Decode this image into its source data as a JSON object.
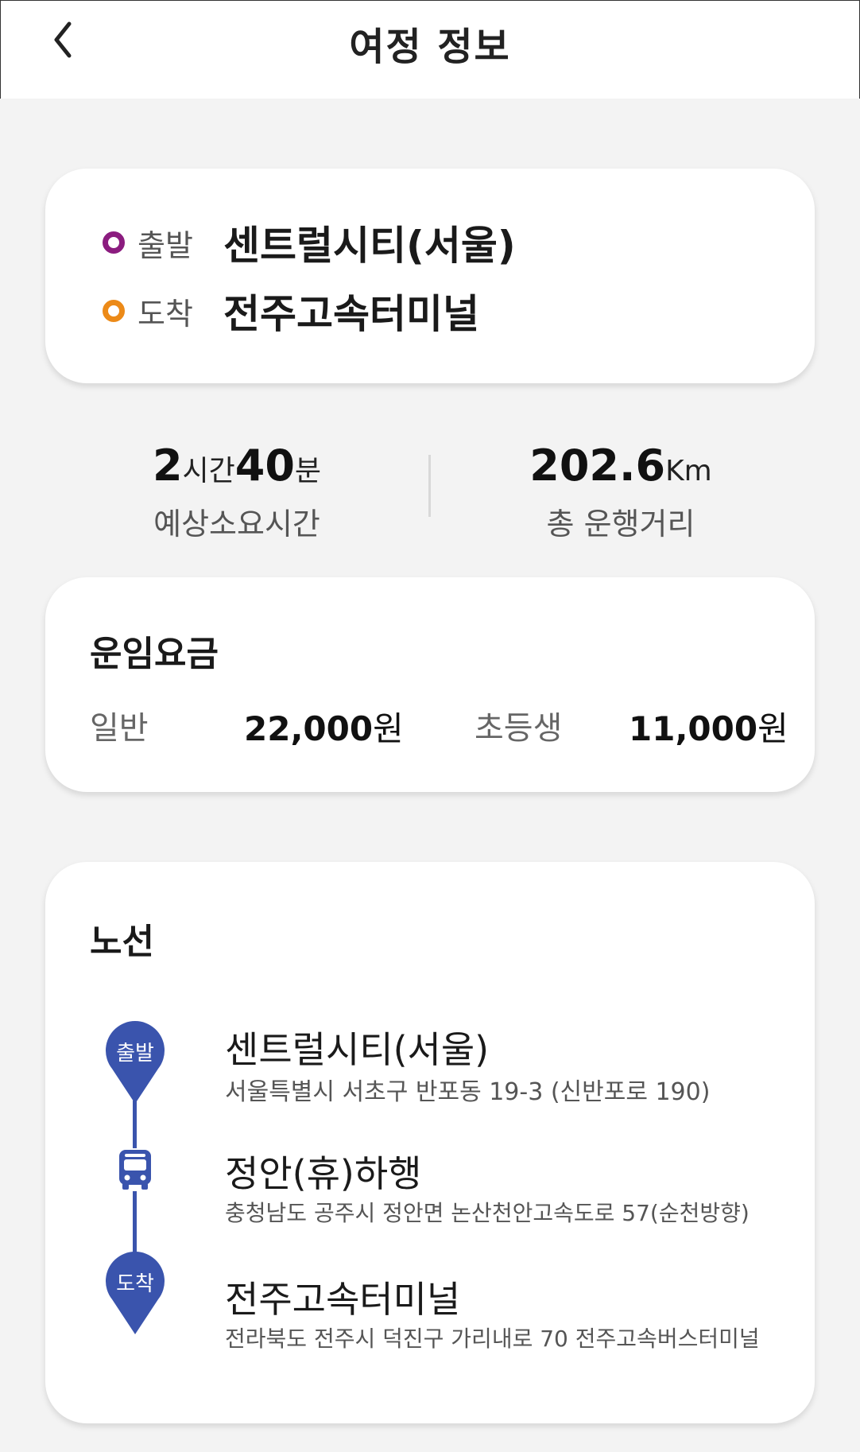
{
  "header": {
    "title": "여정 정보"
  },
  "summary": {
    "departure": {
      "tag": "출발",
      "name": "센트럴시티(서울)",
      "dot_color": "#8b1c7f"
    },
    "arrival": {
      "tag": "도착",
      "name": "전주고속터미널",
      "dot_color": "#ec8a18"
    }
  },
  "stats": {
    "duration": {
      "hours": "2",
      "hours_unit": "시간",
      "minutes": "40",
      "minutes_unit": "분",
      "label": "예상소요시간"
    },
    "distance": {
      "value": "202.6",
      "unit": "Km",
      "label": "총 운행거리"
    }
  },
  "fare": {
    "title": "운임요금",
    "adult": {
      "label": "일반",
      "price": "22,000",
      "unit": "원"
    },
    "child": {
      "label": "초등생",
      "price": "11,000",
      "unit": "원"
    }
  },
  "route": {
    "title": "노선",
    "accent_color": "#3a54ad",
    "stops": [
      {
        "pin_label": "출발",
        "name": "센트럴시티(서울)",
        "address": "서울특별시 서초구 반포동 19-3 (신반포로 190)"
      },
      {
        "name": "정안(휴)하행",
        "address": "충청남도 공주시 정안면 논산천안고속도로 57(순천방향)"
      },
      {
        "pin_label": "도착",
        "name": "전주고속터미널",
        "address": "전라북도 전주시 덕진구 가리내로 70 전주고속버스터미널"
      }
    ]
  }
}
